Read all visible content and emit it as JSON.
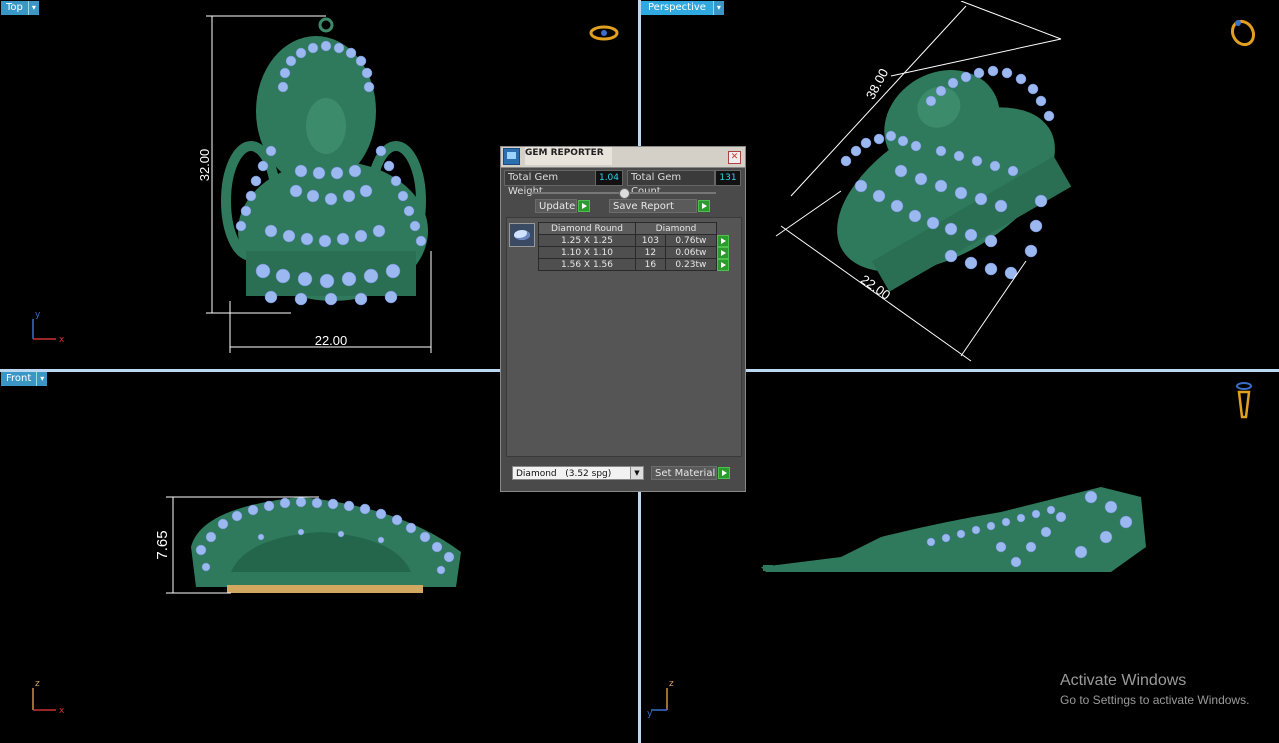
{
  "viewports": {
    "top": {
      "label": "Top",
      "dim_height": "32.00",
      "dim_width": "22.00",
      "axis_v": "y",
      "axis_h": "x"
    },
    "perspective": {
      "label": "Perspective",
      "dim_a": "38.00",
      "dim_b": "22.00"
    },
    "front": {
      "label": "Front",
      "dim_height": "7.65",
      "axis_v": "z",
      "axis_h": "x"
    },
    "right": {
      "axis_v": "z",
      "axis_h": "y"
    }
  },
  "gem_reporter": {
    "title": "GEM REPORTER",
    "total_weight_label": "Total Gem Weight",
    "total_weight": "1.04",
    "total_count_label": "Total Gem Count",
    "total_count": "131",
    "update_label": "Update",
    "save_report_label": "Save Report",
    "table_header": {
      "shape": "Diamond Round",
      "material": "Diamond"
    },
    "rows": [
      {
        "size": "1.25 X 1.25",
        "count": "103",
        "weight": "0.76tw"
      },
      {
        "size": "1.10 X 1.10",
        "count": "12",
        "weight": "0.06tw"
      },
      {
        "size": "1.56 X 1.56",
        "count": "16",
        "weight": "0.23tw"
      }
    ],
    "material_select": "Diamond   (3.52 spg)",
    "set_material_label": "Set Material"
  },
  "watermark": {
    "line1": "Activate Windows",
    "line2": "Go to Settings to activate Windows."
  },
  "colors": {
    "metal": "#2f7a5c",
    "gem": "#9cb8f0",
    "viewport_border": "#bcd7f0",
    "tab": "#3a97c5"
  }
}
